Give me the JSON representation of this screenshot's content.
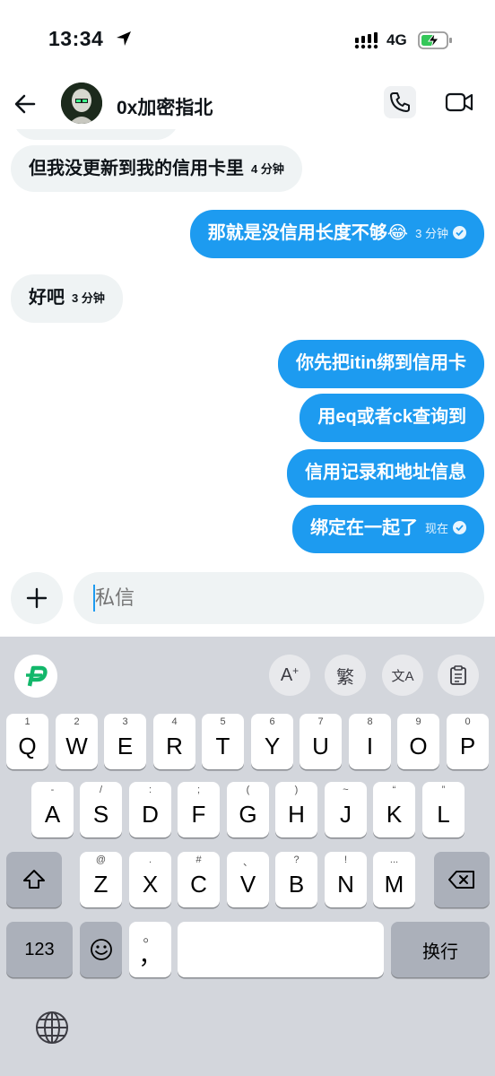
{
  "status_bar": {
    "time": "13:34",
    "network": "4G"
  },
  "header": {
    "contact_name": "0x加密指北"
  },
  "messages": [
    {
      "side": "received",
      "text": "但我没更新到我的信用卡里",
      "time": "4 分钟"
    },
    {
      "side": "sent",
      "text": "那就是没信用长度不够😂",
      "time": "3 分钟",
      "read": true
    },
    {
      "side": "received",
      "text": "好吧",
      "time": "3 分钟"
    },
    {
      "side": "sent",
      "text": "你先把itin绑到信用卡"
    },
    {
      "side": "sent",
      "text": "用eq或者ck查询到"
    },
    {
      "side": "sent",
      "text": "信用记录和地址信息"
    },
    {
      "side": "sent",
      "text": "绑定在一起了",
      "time": "现在",
      "read": true
    }
  ],
  "composer": {
    "placeholder": "私信"
  },
  "keyboard": {
    "toolbar": {
      "ai_label": "A",
      "traditional_label": "繁",
      "translate_label": "文A"
    },
    "row1": [
      {
        "key": "Q",
        "hint": "1"
      },
      {
        "key": "W",
        "hint": "2"
      },
      {
        "key": "E",
        "hint": "3"
      },
      {
        "key": "R",
        "hint": "4"
      },
      {
        "key": "T",
        "hint": "5"
      },
      {
        "key": "Y",
        "hint": "6"
      },
      {
        "key": "U",
        "hint": "7"
      },
      {
        "key": "I",
        "hint": "8"
      },
      {
        "key": "O",
        "hint": "9"
      },
      {
        "key": "P",
        "hint": "0"
      }
    ],
    "row2": [
      {
        "key": "A",
        "hint": "-"
      },
      {
        "key": "S",
        "hint": "/"
      },
      {
        "key": "D",
        "hint": ":"
      },
      {
        "key": "F",
        "hint": ";"
      },
      {
        "key": "G",
        "hint": "("
      },
      {
        "key": "H",
        "hint": ")"
      },
      {
        "key": "J",
        "hint": "~"
      },
      {
        "key": "K",
        "hint": "“"
      },
      {
        "key": "L",
        "hint": "”"
      }
    ],
    "row3": [
      {
        "key": "Z",
        "hint": "@"
      },
      {
        "key": "X",
        "hint": "."
      },
      {
        "key": "C",
        "hint": "#"
      },
      {
        "key": "V",
        "hint": "、"
      },
      {
        "key": "B",
        "hint": "?"
      },
      {
        "key": "N",
        "hint": "!"
      },
      {
        "key": "M",
        "hint": "..."
      }
    ],
    "numbers_label": "123",
    "comma_label": "，",
    "comma_hint": "。",
    "return_label": "换行"
  }
}
